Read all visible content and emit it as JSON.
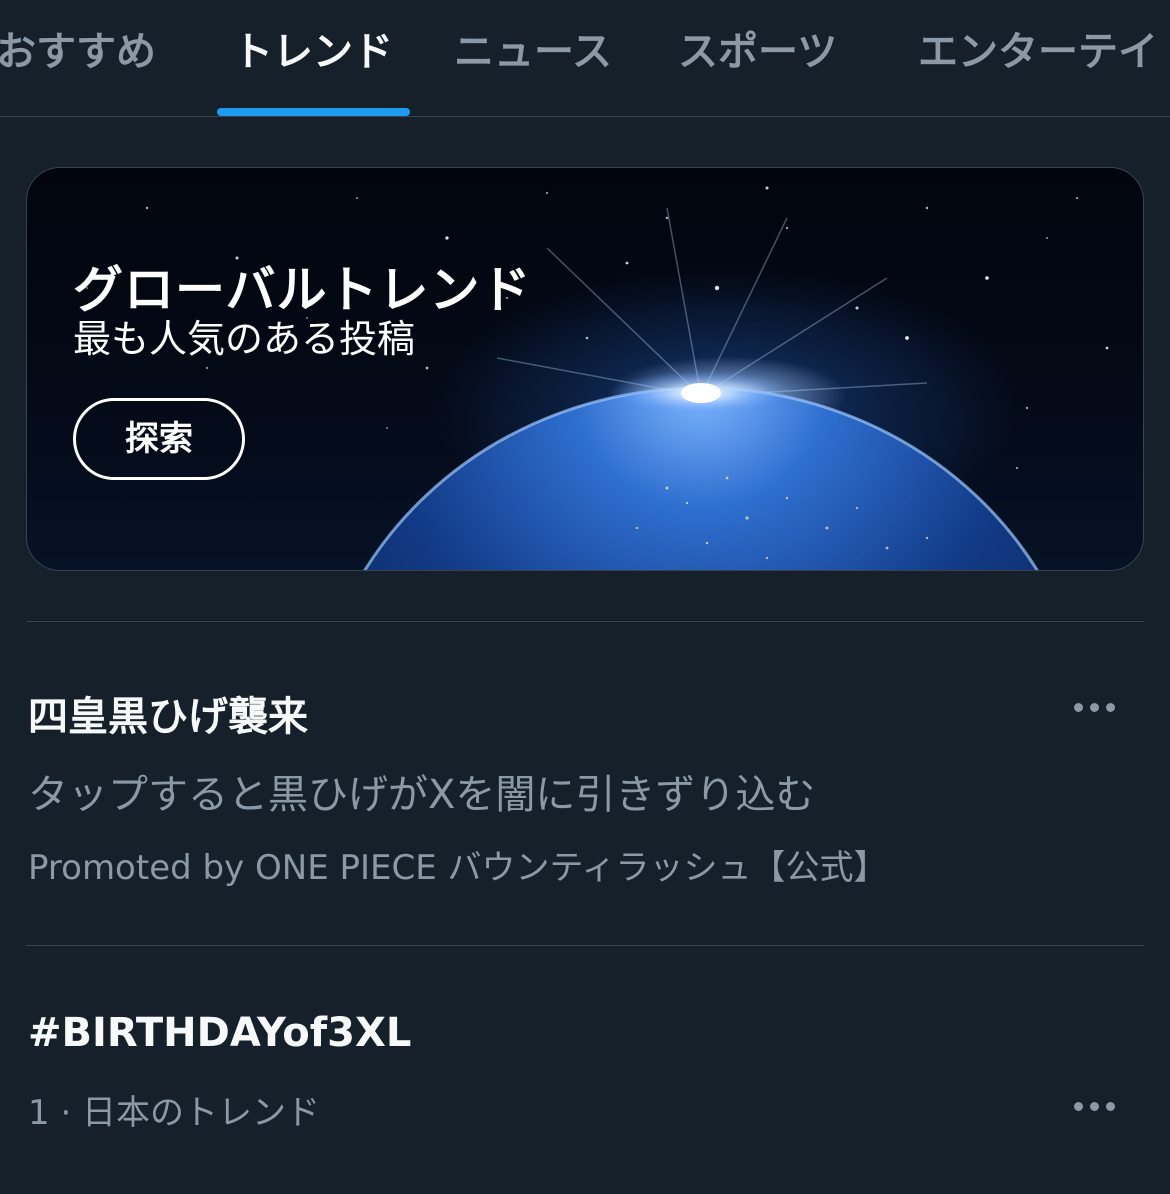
{
  "tabs": [
    {
      "label": "おすすめ",
      "active": false
    },
    {
      "label": "トレンド",
      "active": true
    },
    {
      "label": "ニュース",
      "active": false
    },
    {
      "label": "スポーツ",
      "active": false
    },
    {
      "label": "エンターテイ",
      "active": false
    }
  ],
  "banner": {
    "title": "グローバルトレンド",
    "subtitle": "最も人気のある投稿",
    "button_label": "探索"
  },
  "trends": [
    {
      "title": "四皇黒ひげ襲来",
      "description": "タップすると黒ひげがXを闇に引きずり込む",
      "meta": "Promoted by ONE PIECE バウンティラッシュ【公式】",
      "more_icon": "more-horizontal-icon"
    },
    {
      "title": "#BIRTHDAYof3XL",
      "meta": "1 · 日本のトレンド",
      "more_icon": "more-horizontal-icon"
    }
  ],
  "colors": {
    "background": "#15202b",
    "accent": "#1d9bf0",
    "secondary_text": "#8b98a5",
    "divider": "#38444d"
  }
}
